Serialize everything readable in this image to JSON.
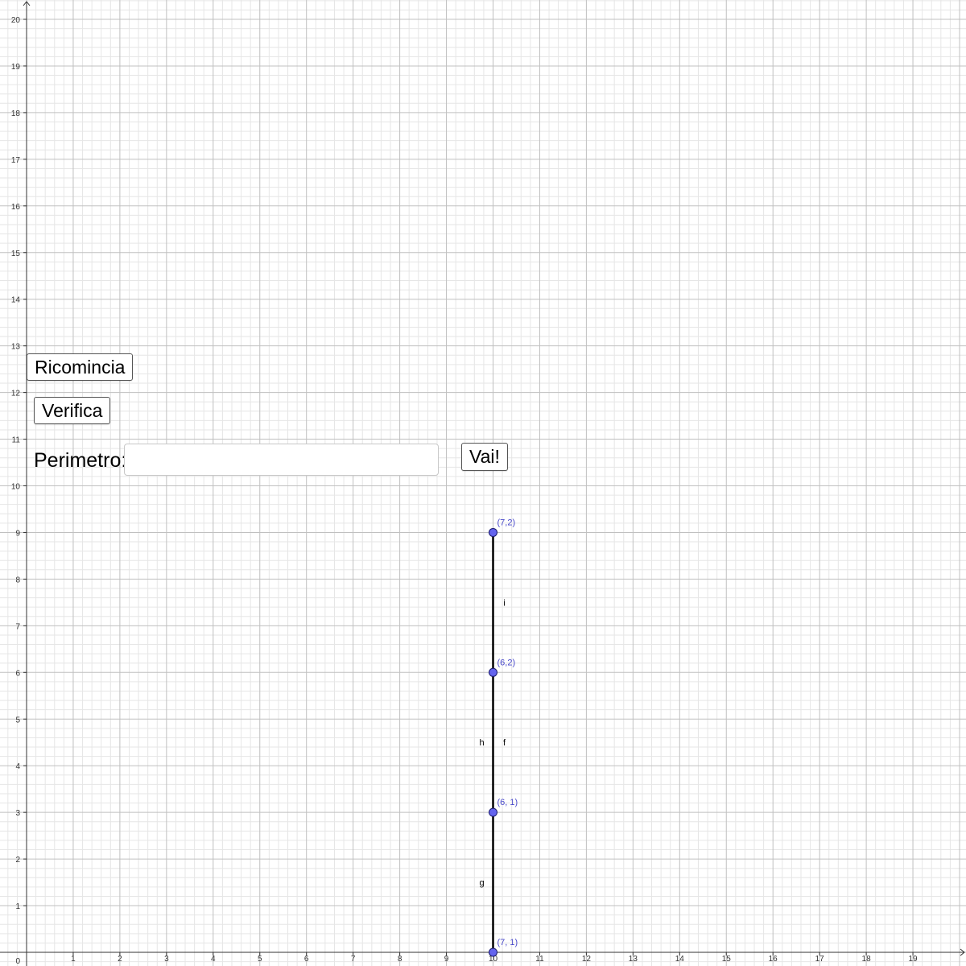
{
  "graphics": {
    "x_range": [
      0,
      20
    ],
    "y_range": [
      0,
      20
    ],
    "x_tick_labels": [
      "1",
      "2",
      "3",
      "4",
      "5",
      "6",
      "7",
      "8",
      "9",
      "10",
      "11",
      "12",
      "13",
      "14",
      "15",
      "16",
      "17",
      "18",
      "19"
    ],
    "y_tick_labels": [
      "1",
      "2",
      "3",
      "4",
      "5",
      "6",
      "7",
      "8",
      "9",
      "10",
      "11",
      "12",
      "13",
      "14",
      "15",
      "16",
      "17",
      "18",
      "19",
      "20"
    ],
    "origin_label": "0",
    "grid": true,
    "minor_grid_per_unit": 5,
    "colors": {
      "major_grid": "#c0c0c0",
      "minor_grid": "#e6e6e6",
      "axis": "#333333",
      "segment": "#000000",
      "point_fill": "#6464ee",
      "point_stroke": "#1a1a6e",
      "point_label": "#4a4acb"
    },
    "points": [
      {
        "id": "P1",
        "x": 10,
        "y": 9,
        "label": "(7,2)"
      },
      {
        "id": "P2",
        "x": 10,
        "y": 6,
        "label": "(6,2)"
      },
      {
        "id": "P3",
        "x": 10,
        "y": 3,
        "label": "(6, 1)"
      },
      {
        "id": "P4",
        "x": 10,
        "y": 0,
        "label": "(7, 1)"
      }
    ],
    "segments": [
      {
        "name": "i",
        "from": "P1",
        "to": "P2",
        "label_side": "right"
      },
      {
        "name": "f",
        "from": "P2",
        "to": "P3",
        "label_side": "right"
      },
      {
        "name": "h",
        "from": "P2",
        "to": "P3",
        "label_side": "left"
      },
      {
        "name": "g",
        "from": "P3",
        "to": "P4",
        "label_side": "left"
      }
    ]
  },
  "controls": {
    "ricomincia_label": "Ricomincia",
    "verifica_label": "Verifica",
    "perimeter_label": "Perimetro:",
    "perimeter_value": "",
    "vai_label": "Vai!"
  }
}
